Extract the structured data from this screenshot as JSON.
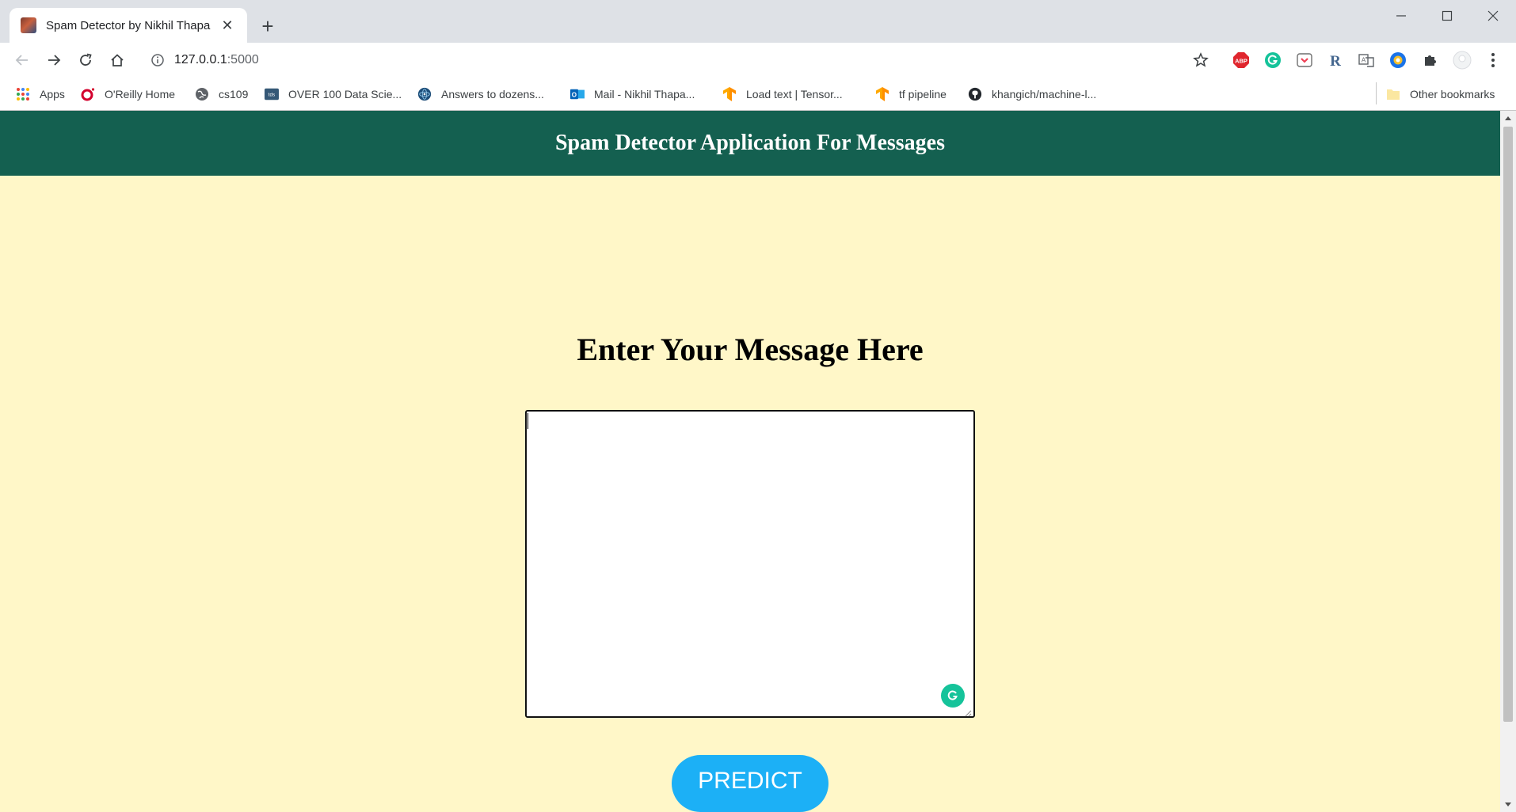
{
  "browser": {
    "tab": {
      "title": "Spam Detector by Nikhil Thapa",
      "close_glyph": "✕"
    },
    "new_tab_glyph": "+",
    "url": {
      "host": "127.0.0.1",
      "port": ":5000"
    },
    "bookmarks": [
      {
        "label": "Apps",
        "icon": "apps-grid-icon"
      },
      {
        "label": "O'Reilly Home",
        "icon": "oreilly-icon"
      },
      {
        "label": "cs109",
        "icon": "globe-icon"
      },
      {
        "label": "OVER 100 Data Scie...",
        "icon": "tds-icon"
      },
      {
        "label": "Answers to dozens...",
        "icon": "atom-icon"
      },
      {
        "label": "Mail - Nikhil Thapa...",
        "icon": "outlook-icon"
      },
      {
        "label": "Load text  |  Tensor...",
        "icon": "tensorflow-icon"
      },
      {
        "label": "tf pipeline",
        "icon": "tensorflow-icon"
      },
      {
        "label": "khangich/machine-l...",
        "icon": "github-icon"
      }
    ],
    "other_bookmarks": "Other bookmarks",
    "extensions": [
      "adblock-icon",
      "grammarly-icon",
      "pocket-icon",
      "r-icon",
      "translate-icon",
      "shield-icon",
      "puzzle-icon",
      "profile-icon",
      "kebab-menu-icon"
    ]
  },
  "page": {
    "header_title": "Spam Detector Application For Messages",
    "heading": "Enter Your Message Here",
    "message": {
      "value": "",
      "placeholder": ""
    },
    "predict_label": "PREDICT"
  },
  "colors": {
    "header_bg": "#146050",
    "page_bg": "#fff7c8",
    "button_bg": "#1cb0f6",
    "grammarly": "#15c39a"
  }
}
